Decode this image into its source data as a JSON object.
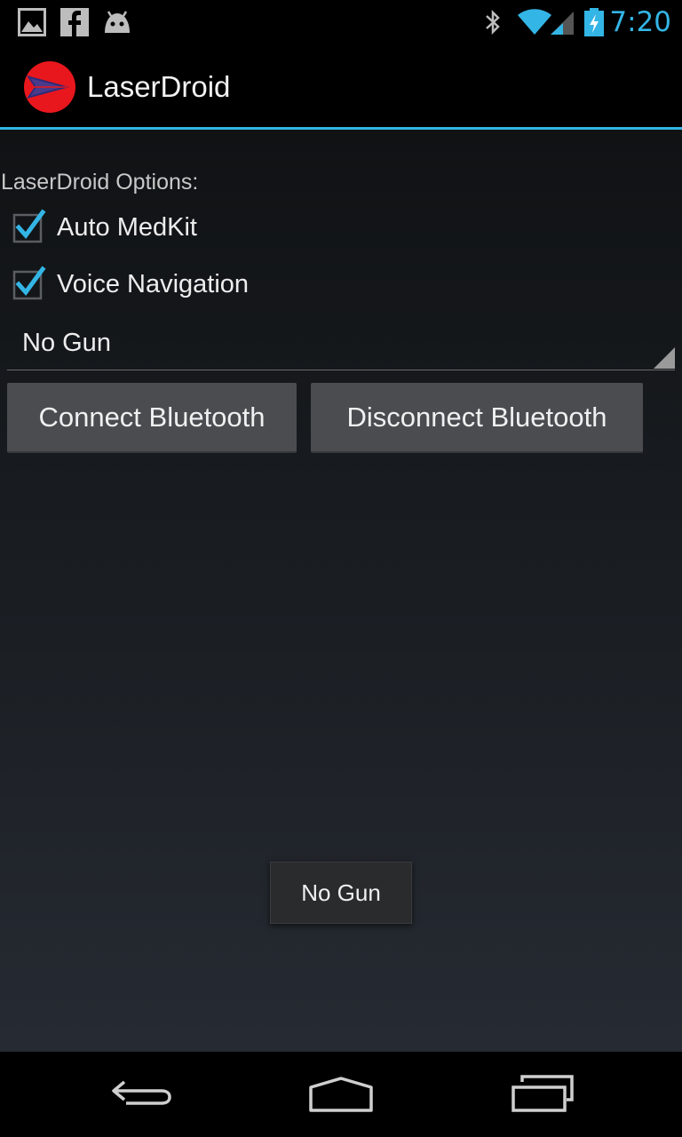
{
  "status_bar": {
    "time": "7:20",
    "icons": [
      "gallery-icon",
      "facebook-icon",
      "android-icon",
      "bluetooth-icon",
      "wifi-icon",
      "signal-icon",
      "battery-charging-icon"
    ],
    "accent_color": "#33b5e5"
  },
  "action_bar": {
    "title": "LaserDroid",
    "logo_icon": "laserdroid-logo-icon"
  },
  "options": {
    "label": "LaserDroid Options:",
    "checkboxes": [
      {
        "label": "Auto MedKit",
        "checked": true
      },
      {
        "label": "Voice Navigation",
        "checked": true
      }
    ]
  },
  "spinner": {
    "selected": "No Gun"
  },
  "buttons": {
    "connect": "Connect Bluetooth",
    "disconnect": "Disconnect Bluetooth"
  },
  "toast": {
    "text": "No Gun"
  },
  "nav_bar": {
    "icons": [
      "back-icon",
      "home-icon",
      "recent-apps-icon"
    ]
  }
}
